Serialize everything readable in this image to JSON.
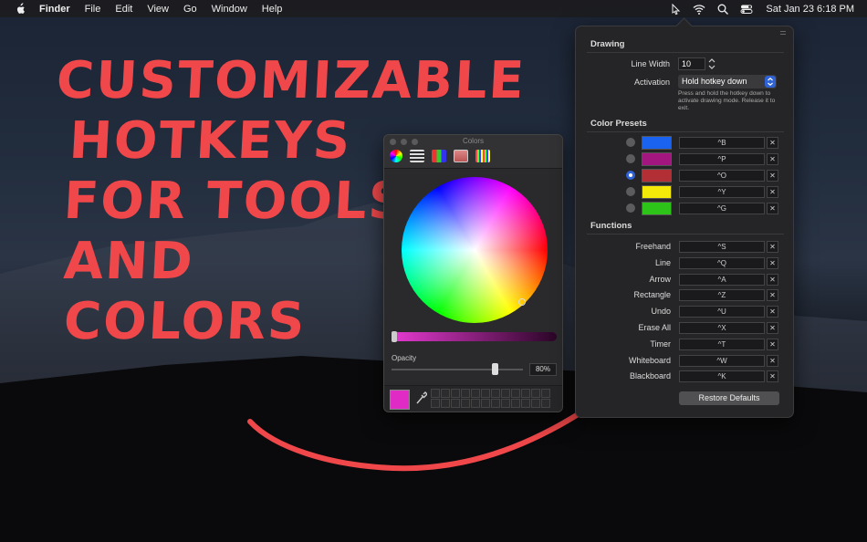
{
  "menubar": {
    "app": "Finder",
    "items": [
      "File",
      "Edit",
      "View",
      "Go",
      "Window",
      "Help"
    ],
    "clock": "Sat Jan 23  6:18 PM"
  },
  "overlay_text": [
    "CUSTOMIZABLE",
    "HOTKEYS",
    "FOR TOOLS",
    "AND",
    "COLORS"
  ],
  "colors_panel": {
    "title": "Colors",
    "opacity_label": "Opacity",
    "opacity_value": "80%",
    "current_color": "#e02bc5"
  },
  "prefs": {
    "drawing_header": "Drawing",
    "line_width_label": "Line Width",
    "line_width_value": "10",
    "activation_label": "Activation",
    "activation_value": "Hold hotkey down",
    "activation_hint": "Press and hold the hotkey down to activate drawing mode. Release it to exit.",
    "presets_header": "Color Presets",
    "presets": [
      {
        "color": "#1a63f0",
        "hotkey": "^B",
        "selected": false
      },
      {
        "color": "#a3157f",
        "hotkey": "^P",
        "selected": false
      },
      {
        "color": "#b32f36",
        "hotkey": "^O",
        "selected": true
      },
      {
        "color": "#f4ea0a",
        "hotkey": "^Y",
        "selected": false
      },
      {
        "color": "#2ec318",
        "hotkey": "^G",
        "selected": false
      }
    ],
    "functions_header": "Functions",
    "functions": [
      {
        "label": "Freehand",
        "hotkey": "^S"
      },
      {
        "label": "Line",
        "hotkey": "^Q"
      },
      {
        "label": "Arrow",
        "hotkey": "^A"
      },
      {
        "label": "Rectangle",
        "hotkey": "^Z"
      },
      {
        "label": "Undo",
        "hotkey": "^U"
      },
      {
        "label": "Erase All",
        "hotkey": "^X"
      },
      {
        "label": "Timer",
        "hotkey": "^T"
      },
      {
        "label": "Whiteboard",
        "hotkey": "^W"
      },
      {
        "label": "Blackboard",
        "hotkey": "^K"
      }
    ],
    "clear_symbol": "✕",
    "restore_label": "Restore Defaults"
  }
}
